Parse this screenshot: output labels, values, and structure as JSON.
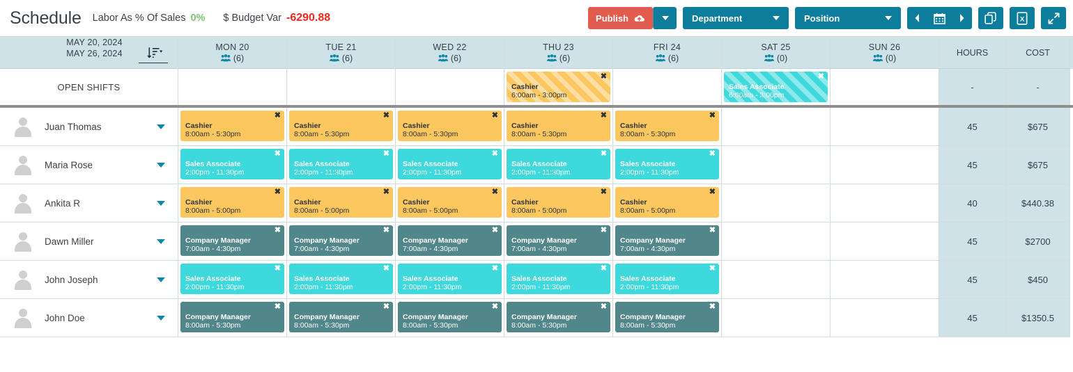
{
  "header": {
    "title": "Schedule",
    "labor_label": "Labor As % Of Sales",
    "labor_value": "0%",
    "budget_label": "$ Budget Var",
    "budget_value": "-6290.88",
    "labor_color": "#7cc576",
    "budget_color": "#f0281e"
  },
  "toolbar": {
    "publish_label": "Publish",
    "department_label": "Department",
    "position_label": "Position",
    "accent_color": "#0e7d9b",
    "publish_color": "#e15b4e"
  },
  "grid": {
    "date_from": "MAY 20, 2024",
    "date_to": "MAY 26, 2024",
    "hours_header": "HOURS",
    "cost_header": "COST",
    "open_shifts_label": "OPEN SHIFTS",
    "open_hours": "-",
    "open_cost": "-",
    "days": [
      {
        "label": "MON 20",
        "count": "(6)"
      },
      {
        "label": "TUE 21",
        "count": "(6)"
      },
      {
        "label": "WED 22",
        "count": "(6)"
      },
      {
        "label": "THU 23",
        "count": "(6)"
      },
      {
        "label": "FRI 24",
        "count": "(6)"
      },
      {
        "label": "SAT 25",
        "count": "(0)"
      },
      {
        "label": "SUN 26",
        "count": "(0)"
      }
    ],
    "open_shifts": [
      null,
      null,
      null,
      {
        "role": "Cashier",
        "time": "6:00am - 3:00pm",
        "kind": "cashier",
        "striped": true
      },
      null,
      {
        "role": "Sales Associate",
        "time": "6:00am - 3:00pm",
        "kind": "sales",
        "striped": true
      },
      null
    ],
    "employees": [
      {
        "name": "Juan Thomas",
        "hours": "45",
        "cost": "$675",
        "shifts": [
          {
            "role": "Cashier",
            "time": "8:00am - 5:30pm",
            "kind": "cashier"
          },
          {
            "role": "Cashier",
            "time": "8:00am - 5:30pm",
            "kind": "cashier"
          },
          {
            "role": "Cashier",
            "time": "8:00am - 5:30pm",
            "kind": "cashier"
          },
          {
            "role": "Cashier",
            "time": "8:00am - 5:30pm",
            "kind": "cashier"
          },
          {
            "role": "Cashier",
            "time": "8:00am - 5:30pm",
            "kind": "cashier"
          },
          null,
          null
        ]
      },
      {
        "name": "Maria Rose",
        "hours": "45",
        "cost": "$675",
        "shifts": [
          {
            "role": "Sales Associate",
            "time": "2:00pm - 11:30pm",
            "kind": "sales"
          },
          {
            "role": "Sales Associate",
            "time": "2:00pm - 11:30pm",
            "kind": "sales"
          },
          {
            "role": "Sales Associate",
            "time": "2:00pm - 11:30pm",
            "kind": "sales"
          },
          {
            "role": "Sales Associate",
            "time": "2:00pm - 11:30pm",
            "kind": "sales"
          },
          {
            "role": "Sales Associate",
            "time": "2:00pm - 11:30pm",
            "kind": "sales"
          },
          null,
          null
        ]
      },
      {
        "name": "Ankita R",
        "hours": "40",
        "cost": "$440.38",
        "shifts": [
          {
            "role": "Cashier",
            "time": "8:00am - 5:00pm",
            "kind": "cashier"
          },
          {
            "role": "Cashier",
            "time": "8:00am - 5:00pm",
            "kind": "cashier"
          },
          {
            "role": "Cashier",
            "time": "8:00am - 5:00pm",
            "kind": "cashier"
          },
          {
            "role": "Cashier",
            "time": "8:00am - 5:00pm",
            "kind": "cashier"
          },
          {
            "role": "Cashier",
            "time": "8:00am - 5:00pm",
            "kind": "cashier"
          },
          null,
          null
        ]
      },
      {
        "name": "Dawn Miller",
        "hours": "45",
        "cost": "$2700",
        "shifts": [
          {
            "role": "Company Manager",
            "time": "7:00am - 4:30pm",
            "kind": "manager"
          },
          {
            "role": "Company Manager",
            "time": "7:00am - 4:30pm",
            "kind": "manager"
          },
          {
            "role": "Company Manager",
            "time": "7:00am - 4:30pm",
            "kind": "manager"
          },
          {
            "role": "Company Manager",
            "time": "7:00am - 4:30pm",
            "kind": "manager"
          },
          {
            "role": "Company Manager",
            "time": "7:00am - 4:30pm",
            "kind": "manager"
          },
          null,
          null
        ]
      },
      {
        "name": "John Joseph",
        "hours": "45",
        "cost": "$450",
        "shifts": [
          {
            "role": "Sales Associate",
            "time": "2:00pm - 11:30pm",
            "kind": "sales"
          },
          {
            "role": "Sales Associate",
            "time": "2:00pm - 11:30pm",
            "kind": "sales"
          },
          {
            "role": "Sales Associate",
            "time": "2:00pm - 11:30pm",
            "kind": "sales"
          },
          {
            "role": "Sales Associate",
            "time": "2:00pm - 11:30pm",
            "kind": "sales"
          },
          {
            "role": "Sales Associate",
            "time": "2:00pm - 11:30pm",
            "kind": "sales"
          },
          null,
          null
        ]
      },
      {
        "name": "John Doe",
        "hours": "45",
        "cost": "$1350.5",
        "shifts": [
          {
            "role": "Company Manager",
            "time": "8:00am - 5:30pm",
            "kind": "manager"
          },
          {
            "role": "Company Manager",
            "time": "8:00am - 5:30pm",
            "kind": "manager"
          },
          {
            "role": "Company Manager",
            "time": "8:00am - 5:30pm",
            "kind": "manager"
          },
          {
            "role": "Company Manager",
            "time": "8:00am - 5:30pm",
            "kind": "manager"
          },
          {
            "role": "Company Manager",
            "time": "8:00am - 5:30pm",
            "kind": "manager"
          },
          null,
          null
        ]
      }
    ]
  },
  "icons": {
    "close": "✖",
    "people": "people-group-icon",
    "publish": "upload-cloud-icon",
    "calendar": "calendar-icon",
    "copy": "copy-icon",
    "excel": "excel-export-icon",
    "expand": "expand-icon",
    "sort": "sort-descending-icon"
  }
}
